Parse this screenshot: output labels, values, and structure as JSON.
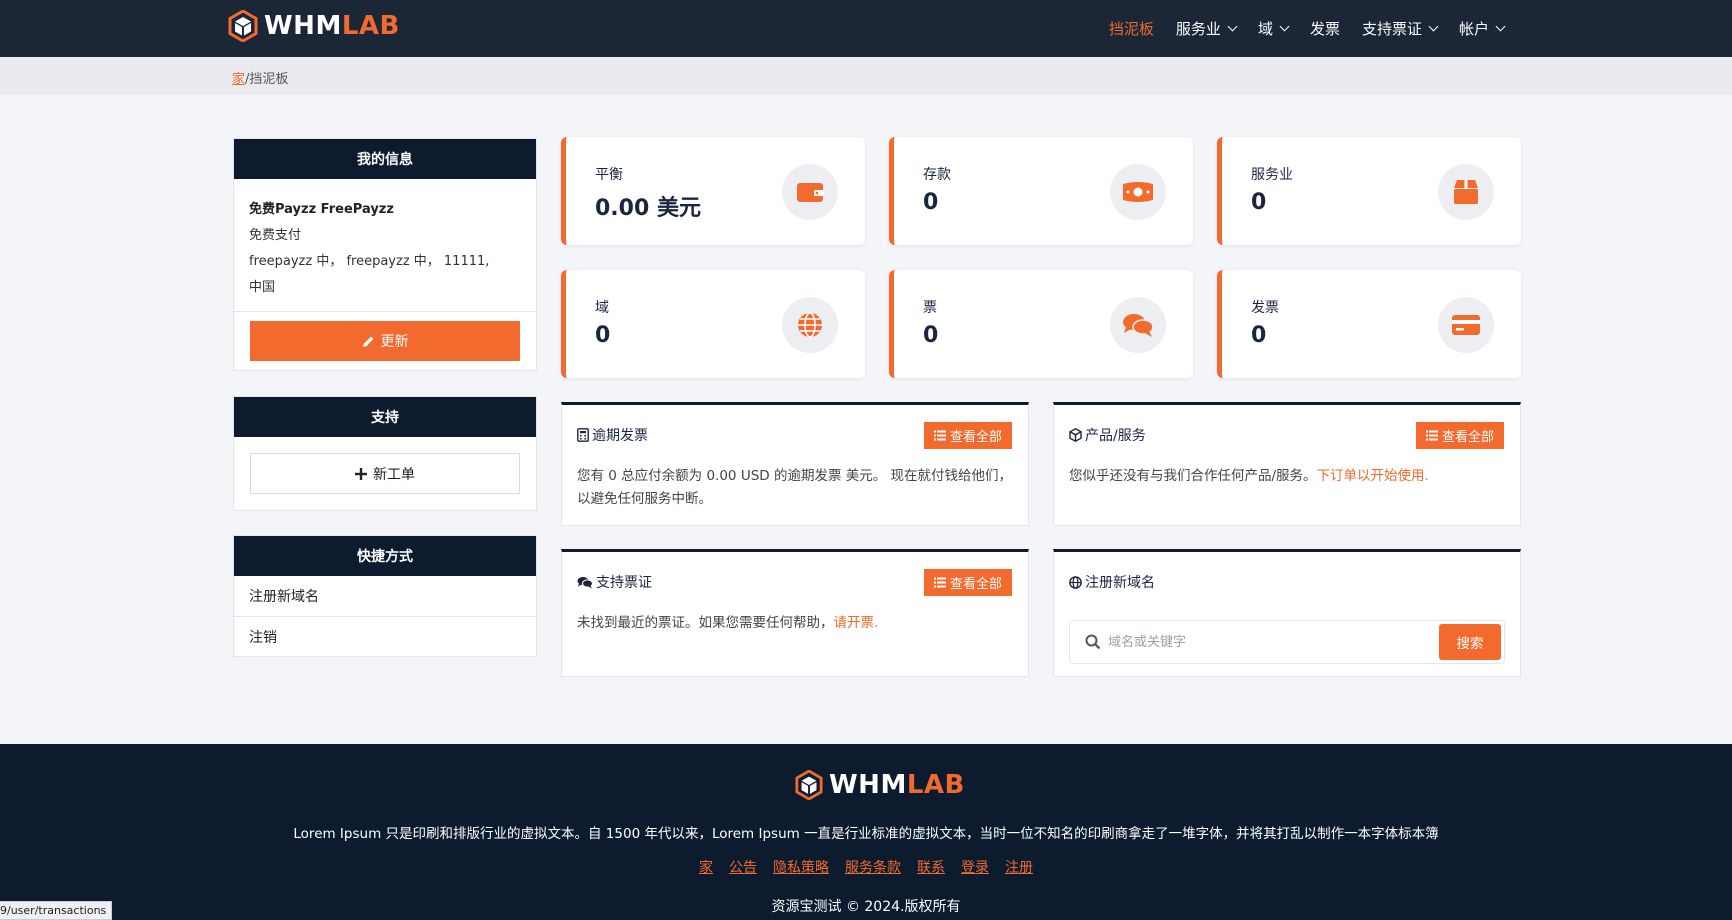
{
  "brand": {
    "part1": "WHM",
    "part2": "LAB",
    "accent_color": "#f26a2e",
    "dark_color": "#0d1b2e"
  },
  "nav": [
    {
      "label": "挡泥板",
      "active": true,
      "dropdown": false
    },
    {
      "label": "服务业",
      "active": false,
      "dropdown": true
    },
    {
      "label": "域",
      "active": false,
      "dropdown": true
    },
    {
      "label": "发票",
      "active": false,
      "dropdown": false
    },
    {
      "label": "支持票证",
      "active": false,
      "dropdown": true
    },
    {
      "label": "帐户",
      "active": false,
      "dropdown": true
    }
  ],
  "breadcrumb": {
    "home": "家",
    "separator": "/",
    "current": "挡泥板"
  },
  "my_info": {
    "title": "我的信息",
    "name": "免费Payzz FreePayzz",
    "company": "免费支付",
    "address": "freepayzz 中， freepayzz 中， 11111,",
    "country": "中国",
    "update_label": "更新"
  },
  "support": {
    "title": "支持",
    "new_ticket_label": "新工单"
  },
  "shortcuts": {
    "title": "快捷方式",
    "items": [
      "注册新域名",
      "注销"
    ]
  },
  "stats": [
    {
      "label": "平衡",
      "value": "0.00 美元",
      "icon": "wallet-icon"
    },
    {
      "label": "存款",
      "value": "0",
      "icon": "money-icon"
    },
    {
      "label": "服务业",
      "value": "0",
      "icon": "box-icon"
    },
    {
      "label": "域",
      "value": "0",
      "icon": "globe-icon"
    },
    {
      "label": "票",
      "value": "0",
      "icon": "chat-icon"
    },
    {
      "label": "发票",
      "value": "0",
      "icon": "card-icon"
    }
  ],
  "panels": {
    "overdue": {
      "title": "逾期发票",
      "button": "查看全部",
      "text": "您有 0 总应付余额为 0.00 USD 的逾期发票 美元。 现在就付钱给他们，以避免任何服务中断。"
    },
    "products": {
      "title": "产品/服务",
      "button": "查看全部",
      "text": "您似乎还没有与我们合作任何产品/服务。",
      "link": "下订单以开始使用."
    },
    "tickets": {
      "title": "支持票证",
      "button": "查看全部",
      "text": "未找到最近的票证。如果您需要任何帮助，",
      "link": "请开票."
    },
    "domain": {
      "title": "注册新域名",
      "placeholder": "域名或关键字",
      "search_label": "搜索"
    }
  },
  "footer": {
    "description": "Lorem Ipsum 只是印刷和排版行业的虚拟文本。自 1500 年代以来，Lorem Ipsum 一直是行业标准的虚拟文本，当时一位不知名的印刷商拿走了一堆字体，并将其打乱以制作一本字体标本簿",
    "links": [
      "家",
      "公告",
      "隐私策略",
      "服务条款",
      "联系",
      "登录",
      "注册"
    ],
    "copyright": "资源宝测试 © 2024.版权所有"
  },
  "status_url": "9/user/transactions"
}
